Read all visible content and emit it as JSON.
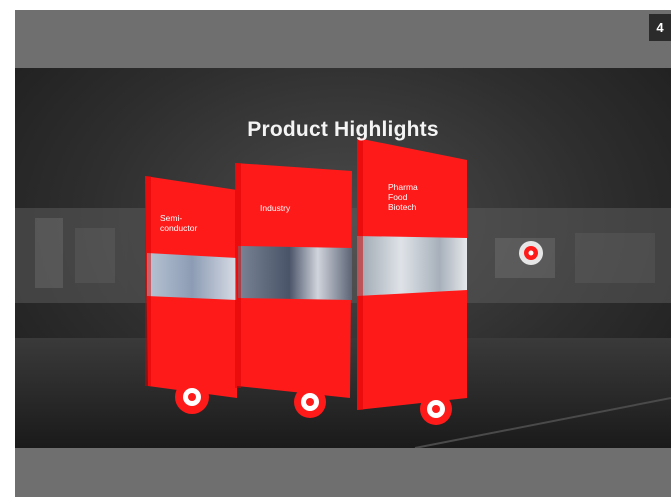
{
  "badge": {
    "page_number": "4"
  },
  "scene": {
    "title": "Product Highlights",
    "panels": [
      {
        "label": "Semi-\nconductor"
      },
      {
        "label": "Industry"
      },
      {
        "label": "Pharma\nFood\nBiotech"
      }
    ]
  },
  "colors": {
    "accent": "#ff1a1a",
    "bar": "#6f6f6f",
    "badge": "#2b2b2b"
  },
  "icons": {
    "hotspot": "target-hotspot-icon"
  }
}
